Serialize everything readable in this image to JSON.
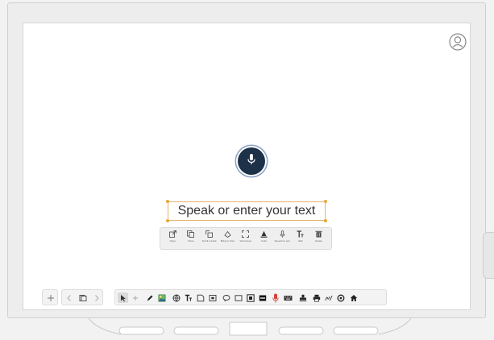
{
  "canvas": {
    "placeholder_text": "Speak or enter your text"
  },
  "icons": {
    "user": "user-profile-icon",
    "mic": "microphone-icon"
  },
  "context_toolbar": {
    "items": [
      {
        "id": "open",
        "label": "Open",
        "icon": "open-external-icon"
      },
      {
        "id": "clone",
        "label": "Clone",
        "icon": "clone-icon"
      },
      {
        "id": "scroll",
        "label": "Scroll to back",
        "icon": "send-back-icon"
      },
      {
        "id": "bring",
        "label": "Bring to front",
        "icon": "bring-front-icon"
      },
      {
        "id": "fullscreen",
        "label": "Full screen",
        "icon": "fullscreen-icon"
      },
      {
        "id": "color",
        "label": "Color",
        "icon": "text-color-icon"
      },
      {
        "id": "speech",
        "label": "Speech to text",
        "icon": "speech-to-text-icon"
      },
      {
        "id": "edit",
        "label": "Edit",
        "icon": "edit-text-icon"
      },
      {
        "id": "delete",
        "label": "Delete",
        "icon": "trash-icon"
      }
    ]
  },
  "bottom_toolbar": {
    "accent_color": "#d6403a",
    "tools": [
      "add-page-icon",
      "previous-page-icon",
      "pages-icon",
      "next-page-icon",
      "select-icon",
      "add-icon",
      "pen-icon",
      "image-icon",
      "globe-icon",
      "text-icon",
      "note-icon",
      "media-icon",
      "lasso-icon",
      "shape-icon",
      "screenshot-icon",
      "fill-icon",
      "microphone-icon",
      "keyboard-icon",
      "stamp-icon",
      "print-icon",
      "signature-icon",
      "settings-icon",
      "home-icon"
    ]
  }
}
